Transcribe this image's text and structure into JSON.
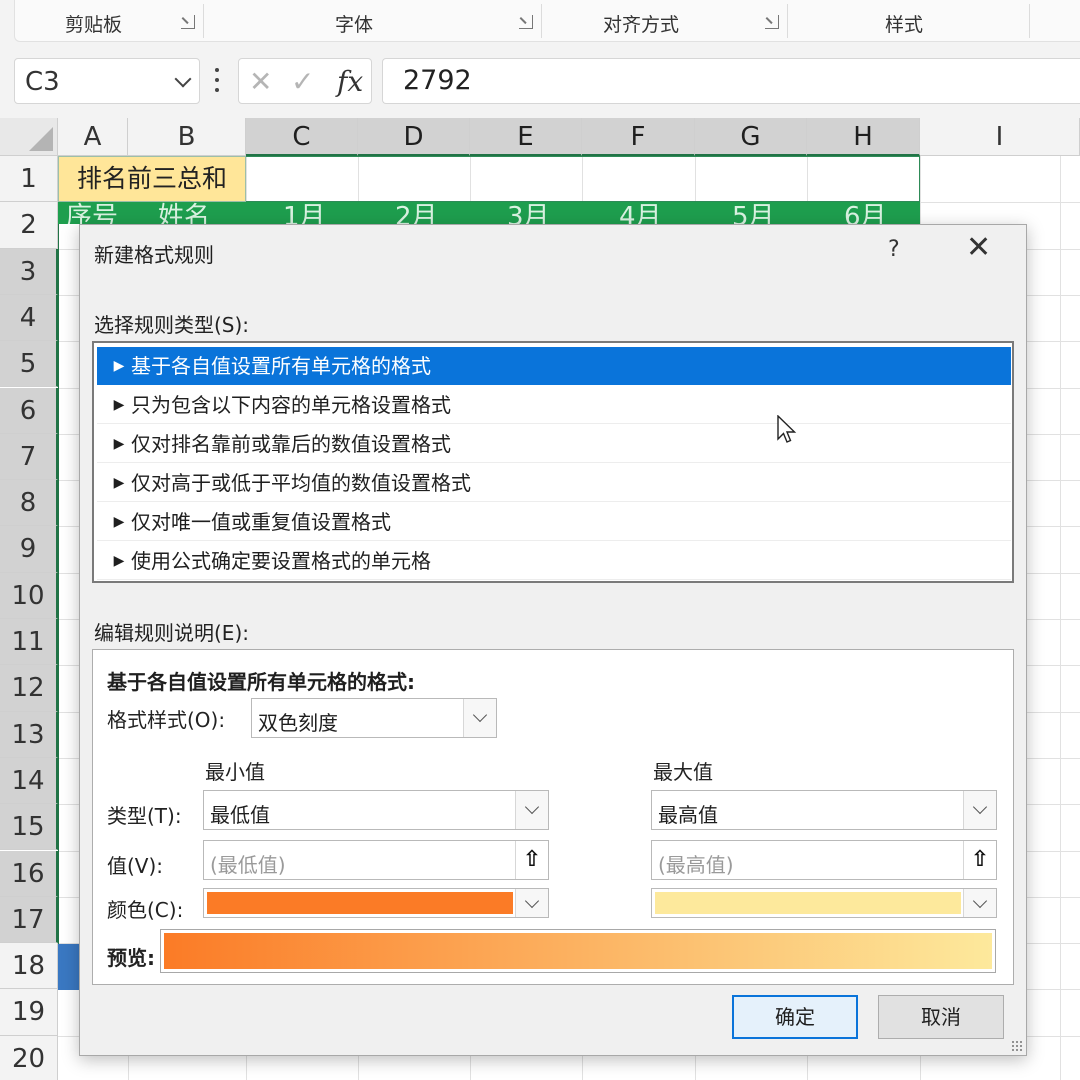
{
  "ribbon": {
    "groups": [
      "剪贴板",
      "字体",
      "对齐方式",
      "样式"
    ]
  },
  "formula_bar": {
    "name_box": "C3",
    "fx_label": "fx",
    "cancel_glyph": "✕",
    "enter_glyph": "✓",
    "value": "2792"
  },
  "sheet": {
    "columns": [
      "A",
      "B",
      "C",
      "D",
      "E",
      "F",
      "G",
      "H",
      "I"
    ],
    "rows": [
      "1",
      "2",
      "3",
      "4",
      "5",
      "6",
      "7",
      "8",
      "9",
      "10",
      "11",
      "12",
      "13",
      "14",
      "15",
      "16",
      "17",
      "18",
      "19",
      "20"
    ],
    "b1_text": "排名前三总和",
    "row2_headers": [
      "序号",
      "姓名",
      "1月",
      "2月",
      "3月",
      "4月",
      "5月",
      "6月"
    ]
  },
  "dialog": {
    "title": "新建格式规则",
    "help": "?",
    "close": "✕",
    "rule_type_label": "选择规则类型(S):",
    "rule_types": [
      "基于各自值设置所有单元格的格式",
      "只为包含以下内容的单元格设置格式",
      "仅对排名靠前或靠后的数值设置格式",
      "仅对高于或低于平均值的数值设置格式",
      "仅对唯一值或重复值设置格式",
      "使用公式确定要设置格式的单元格"
    ],
    "selected_rule_index": 0,
    "edit_label": "编辑规则说明(E):",
    "edit_title": "基于各自值设置所有单元格的格式:",
    "format_style_label": "格式样式(O):",
    "format_style_value": "双色刻度",
    "min_header": "最小值",
    "max_header": "最大值",
    "type_label": "类型(T):",
    "min_type": "最低值",
    "max_type": "最高值",
    "value_label": "值(V):",
    "min_value_placeholder": "(最低值)",
    "max_value_placeholder": "(最高值)",
    "color_label": "颜色(C):",
    "min_color": "#fb7b26",
    "max_color": "#fde99c",
    "preview_label": "预览:",
    "ok": "确定",
    "cancel": "取消"
  }
}
